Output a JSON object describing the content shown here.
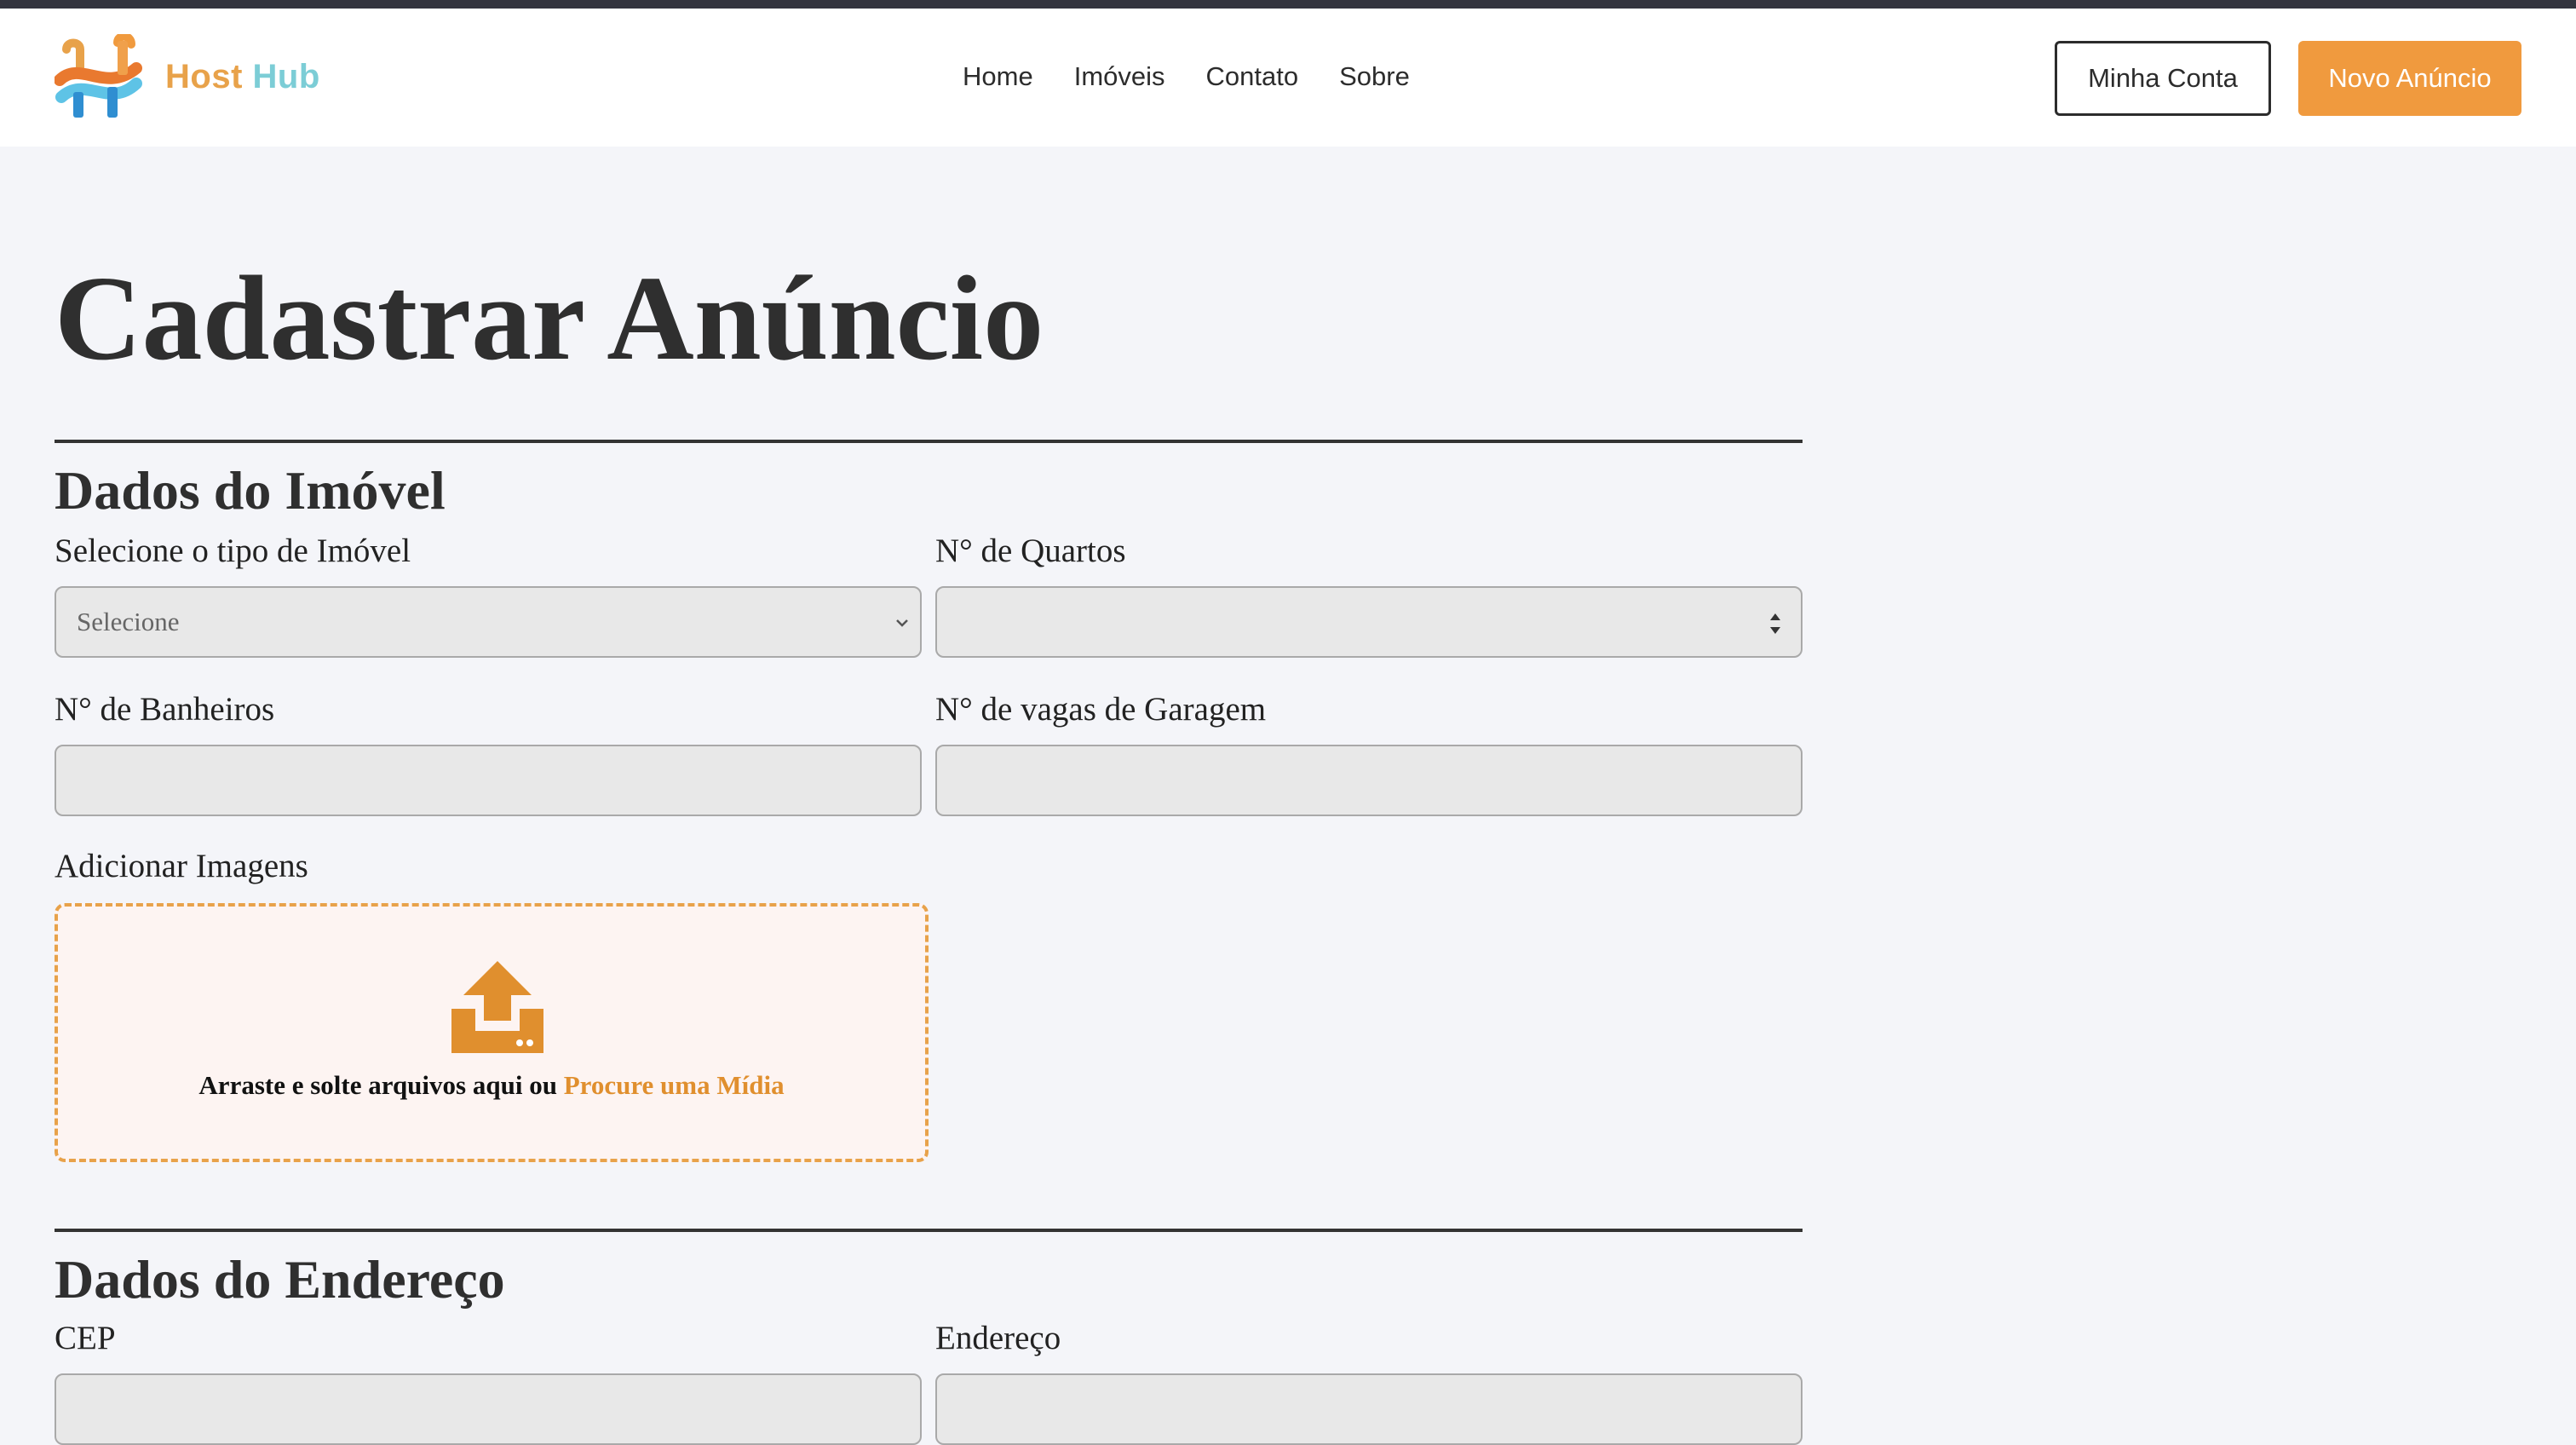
{
  "brand": {
    "name_part1": "Host",
    "name_part2": "Hub",
    "colors": {
      "accent_orange": "#f09a3e",
      "brand_teal": "#7ccdd6",
      "brand_orange": "#e8a24a"
    }
  },
  "nav": {
    "links": [
      {
        "label": "Home"
      },
      {
        "label": "Imóveis"
      },
      {
        "label": "Contato"
      },
      {
        "label": "Sobre"
      }
    ],
    "account_button": "Minha Conta",
    "new_listing_button": "Novo Anúncio"
  },
  "page": {
    "title": "Cadastrar Anúncio"
  },
  "property_section": {
    "heading": "Dados do Imóvel",
    "type_label": "Selecione o tipo de Imóvel",
    "type_value": "Selecione",
    "bedrooms_label": "N° de Quartos",
    "bathrooms_label": "N° de Banheiros",
    "garage_label": "N° de vagas de Garagem",
    "images_label": "Adicionar Imagens",
    "dropzone_text": "Arraste e solte arquivos aqui ou",
    "dropzone_link": "Procure uma Mídia"
  },
  "address_section": {
    "heading": "Dados do Endereço",
    "cep_label": "CEP",
    "address_label": "Endereço"
  },
  "icons": [
    "logo-icon",
    "chevron-down-icon",
    "spinner-arrows-icon",
    "upload-icon"
  ]
}
